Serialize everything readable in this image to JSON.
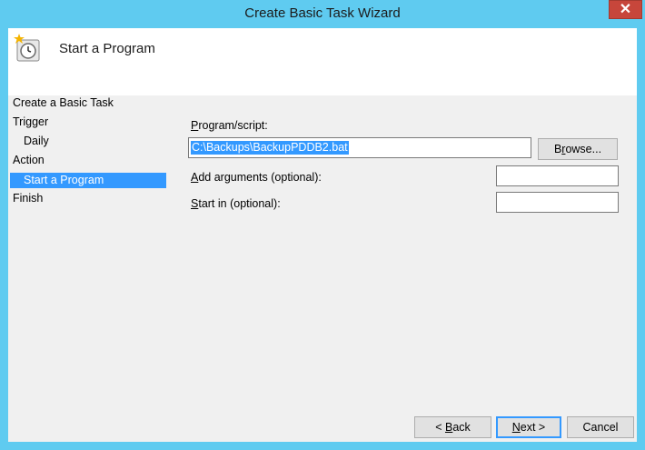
{
  "window": {
    "title": "Create Basic Task Wizard",
    "close_glyph": "✕"
  },
  "header": {
    "title": "Start a Program",
    "icon": "clock-icon"
  },
  "steps": [
    {
      "label": "Create a Basic Task",
      "indent": false,
      "selected": false
    },
    {
      "label": "Trigger",
      "indent": false,
      "selected": false
    },
    {
      "label": "Daily",
      "indent": true,
      "selected": false
    },
    {
      "label": "Action",
      "indent": false,
      "selected": false
    },
    {
      "label": "Start a Program",
      "indent": true,
      "selected": true
    },
    {
      "label": "Finish",
      "indent": false,
      "selected": false
    }
  ],
  "form": {
    "program_label_key": "P",
    "program_label_rest": "rogram/script:",
    "program_value": "C:\\Backups\\BackupPDDB2.bat",
    "browse_key": "r",
    "browse_pre": "B",
    "browse_post": "owse...",
    "args_key": "A",
    "args_rest": "dd arguments (optional):",
    "args_value": "",
    "start_key": "S",
    "start_rest": "tart in (optional):",
    "start_value": ""
  },
  "buttons": {
    "back_pre": "< ",
    "back_key": "B",
    "back_post": "ack",
    "next_key": "N",
    "next_post": "ext >",
    "cancel": "Cancel"
  },
  "colors": {
    "frame": "#5fcbf0",
    "selection": "#3399ff",
    "close": "#c7463b"
  }
}
